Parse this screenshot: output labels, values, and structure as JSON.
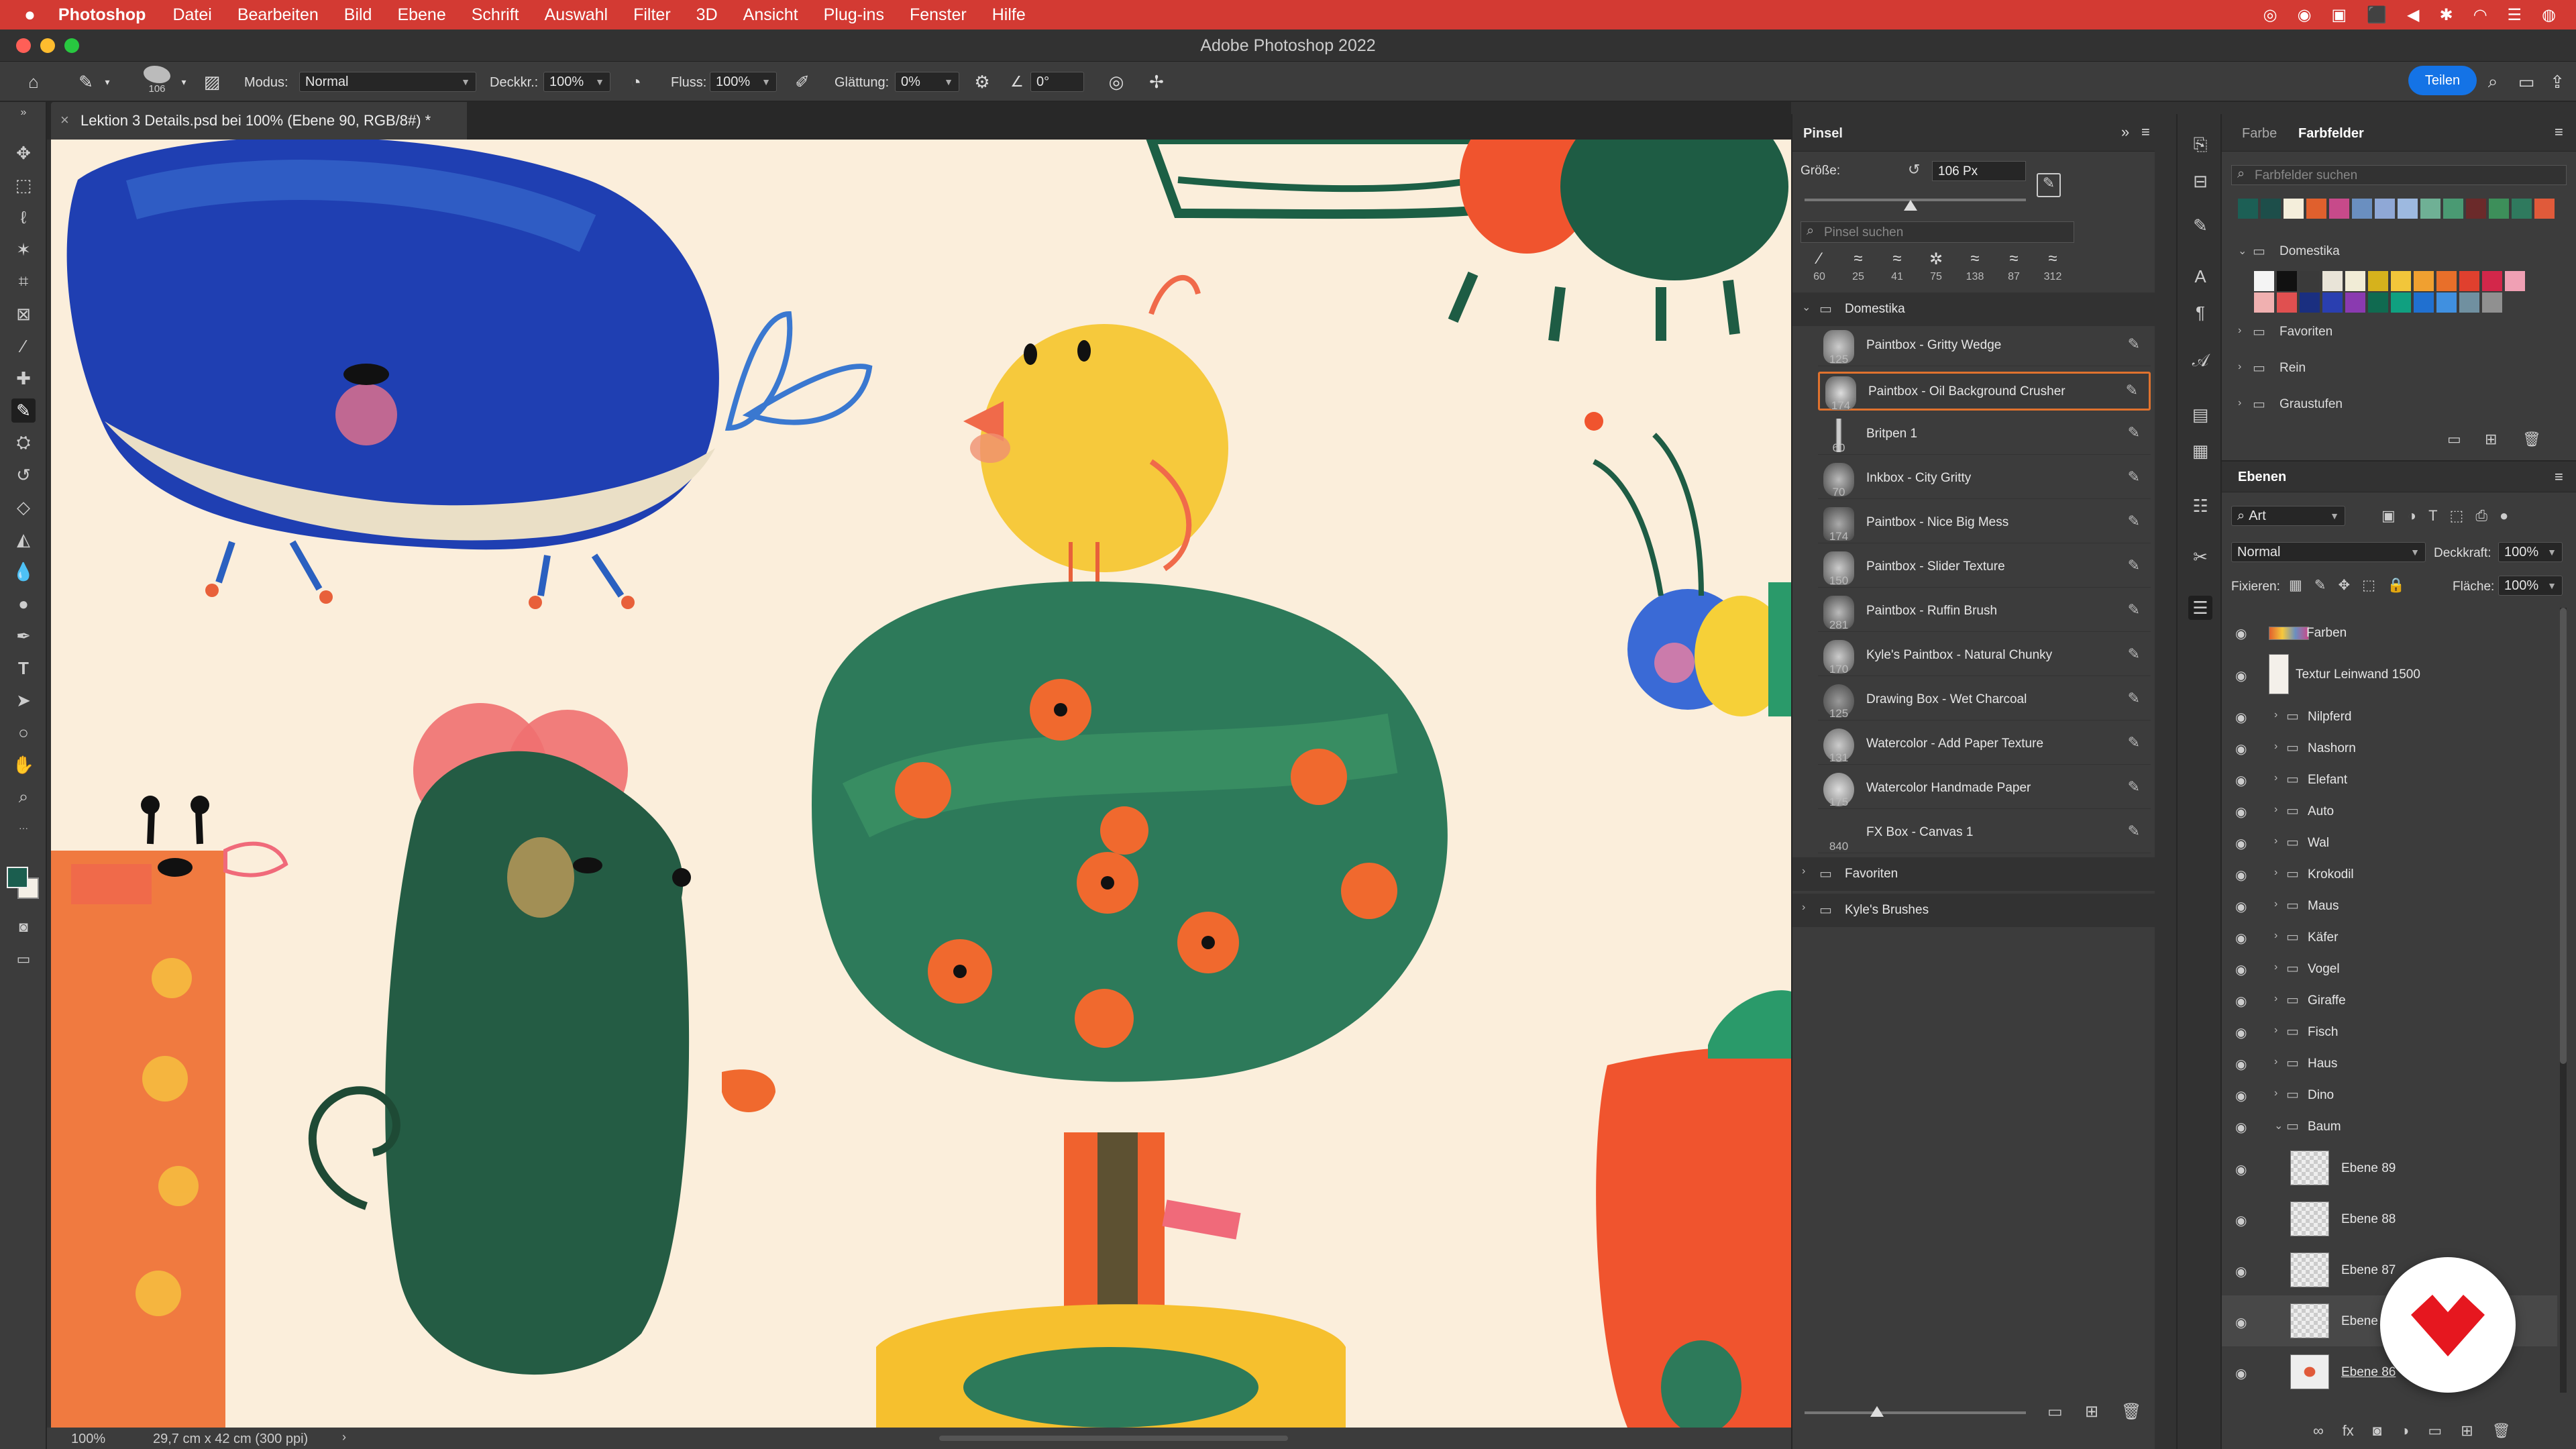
{
  "menubar": {
    "items": [
      "Photoshop",
      "Datei",
      "Bearbeiten",
      "Bild",
      "Ebene",
      "Schrift",
      "Auswahl",
      "Filter",
      "3D",
      "Ansicht",
      "Plug-ins",
      "Fenster",
      "Hilfe"
    ]
  },
  "window": {
    "title": "Adobe Photoshop 2022"
  },
  "options": {
    "brush_size": "106",
    "modus_label": "Modus:",
    "modus_value": "Normal",
    "deckkr_label": "Deckkr.:",
    "deckkr_value": "100%",
    "fluss_label": "Fluss:",
    "fluss_value": "100%",
    "glaettung_label": "Glättung:",
    "glaettung_value": "0%",
    "angle_value": "0°",
    "share_label": "Teilen"
  },
  "document": {
    "tab_title": "Lektion 3 Details.psd bei 100% (Ebene 90, RGB/8#) *",
    "zoom": "100%",
    "doc_size": "29,7 cm x 42 cm (300 ppi)"
  },
  "pinsel": {
    "tab": "Pinsel",
    "size_label": "Größe:",
    "size_value": "106 Px",
    "search_placeholder": "Pinsel suchen",
    "recent_sizes": [
      "60",
      "25",
      "41",
      "75",
      "138",
      "87",
      "312"
    ],
    "group_open": "Domestika",
    "brushes": [
      {
        "size": "125",
        "name": "Paintbox - Gritty Wedge"
      },
      {
        "size": "174",
        "name": "Paintbox - Oil Background Crusher"
      },
      {
        "size": "60",
        "name": "Britpen 1"
      },
      {
        "size": "70",
        "name": "Inkbox - City Gritty"
      },
      {
        "size": "174",
        "name": "Paintbox - Nice Big Mess"
      },
      {
        "size": "150",
        "name": "Paintbox - Slider Texture"
      },
      {
        "size": "281",
        "name": "Paintbox - Ruffin Brush"
      },
      {
        "size": "170",
        "name": "Kyle's Paintbox - Natural Chunky"
      },
      {
        "size": "125",
        "name": "Drawing Box - Wet Charcoal"
      },
      {
        "size": "131",
        "name": "Watercolor - Add Paper Texture"
      },
      {
        "size": "175",
        "name": "Watercolor Handmade Paper"
      },
      {
        "size": "840",
        "name": "FX Box - Canvas 1"
      }
    ],
    "groups_closed": [
      "Favoriten",
      "Kyle's Brushes"
    ]
  },
  "swatches": {
    "tab_farbe": "Farbe",
    "tab_farbfelder": "Farbfelder",
    "search_placeholder": "Farbfelder suchen",
    "recent_colors": [
      "#1c5f55",
      "#1d4e4a",
      "#f4eedb",
      "#e0602d",
      "#c74a8a",
      "#6a8fc0",
      "#8fa8d6",
      "#9db9e0",
      "#6fb095",
      "#4a9a73",
      "#6b2a2a",
      "#3d8f5a",
      "#2f7a5e",
      "#e05a3a"
    ],
    "folders": [
      "Domestika",
      "Favoriten",
      "Rein",
      "Graustufen"
    ],
    "domestika_colors_row1": [
      "#f4f4f4",
      "#111111",
      "#3a3a3a",
      "#e9e4d8",
      "#f1ecd6",
      "#d6b21c",
      "#f2c63a",
      "#f0a030",
      "#e86f2a",
      "#e0402e",
      "#d3274a",
      "#f0a0b4"
    ],
    "domestika_colors_row2": [
      "#f0b0b0",
      "#e05050",
      "#1a2f80",
      "#2a3fb0",
      "#8a3ab0",
      "#106a50",
      "#10a080",
      "#2070d0",
      "#4090e0",
      "#7090a0",
      "#909090"
    ]
  },
  "layers": {
    "tab": "Ebenen",
    "filter": "Art",
    "blend": "Normal",
    "opacity_label": "Deckkraft:",
    "opacity_value": "100%",
    "fix_label": "Fixieren:",
    "fill_label": "Fläche:",
    "fill_value": "100%",
    "items": [
      {
        "name": "Farben",
        "type": "layer"
      },
      {
        "name": "Textur Leinwand 1500",
        "type": "layer"
      },
      {
        "name": "Nilpferd",
        "type": "group"
      },
      {
        "name": "Nashorn",
        "type": "group"
      },
      {
        "name": "Elefant",
        "type": "group"
      },
      {
        "name": "Auto",
        "type": "group"
      },
      {
        "name": "Wal",
        "type": "group"
      },
      {
        "name": "Krokodil",
        "type": "group"
      },
      {
        "name": "Maus",
        "type": "group"
      },
      {
        "name": "Käfer",
        "type": "group"
      },
      {
        "name": "Vogel",
        "type": "group"
      },
      {
        "name": "Giraffe",
        "type": "group"
      },
      {
        "name": "Fisch",
        "type": "group"
      },
      {
        "name": "Haus",
        "type": "group"
      },
      {
        "name": "Dino",
        "type": "group"
      },
      {
        "name": "Baum",
        "type": "group-open"
      },
      {
        "name": "Ebene 89",
        "type": "layer"
      },
      {
        "name": "Ebene 88",
        "type": "layer"
      },
      {
        "name": "Ebene 87",
        "type": "layer"
      },
      {
        "name": "Ebene",
        "type": "layer"
      },
      {
        "name": "Ebene 86",
        "type": "layer"
      }
    ]
  },
  "colors": {
    "menubar": "#d33a33",
    "panel": "#3c3c3c",
    "canvas_bg": "#fbeedb",
    "accent": "#1473e6",
    "selection_border": "#e0722e"
  }
}
